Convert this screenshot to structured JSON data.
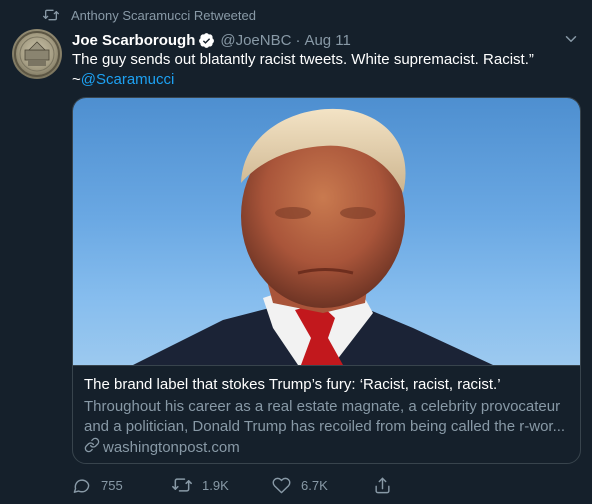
{
  "retweet": {
    "label": "Anthony Scaramucci Retweeted",
    "icon": "retweet-icon"
  },
  "author": {
    "name": "Joe Scarborough",
    "verified_icon": "verified-badge-icon",
    "handle": "@JoeNBC",
    "separator": "·",
    "date": "Aug 11"
  },
  "tweet": {
    "text": "The guy sends out blatantly racist tweets. White supremacist. Racist.”",
    "prefix": "~",
    "mention": "@Scaramucci"
  },
  "card": {
    "title": "The brand label that stokes Trump’s fury: ‘Racist, racist, racist.’",
    "desc_line1": "Throughout his career as a real estate magnate, a celebrity provocateur",
    "desc_line2": "and a politician, Donald Trump has recoiled from being called the r-wor...",
    "domain": "washingtonpost.com",
    "link_icon": "link-icon"
  },
  "actions": {
    "replies": "755",
    "retweets": "1.9K",
    "likes": "6.7K"
  },
  "colors": {
    "background": "#15202b",
    "secondary_text": "#8899a6",
    "accent": "#1da1f2",
    "border": "#38444d"
  }
}
